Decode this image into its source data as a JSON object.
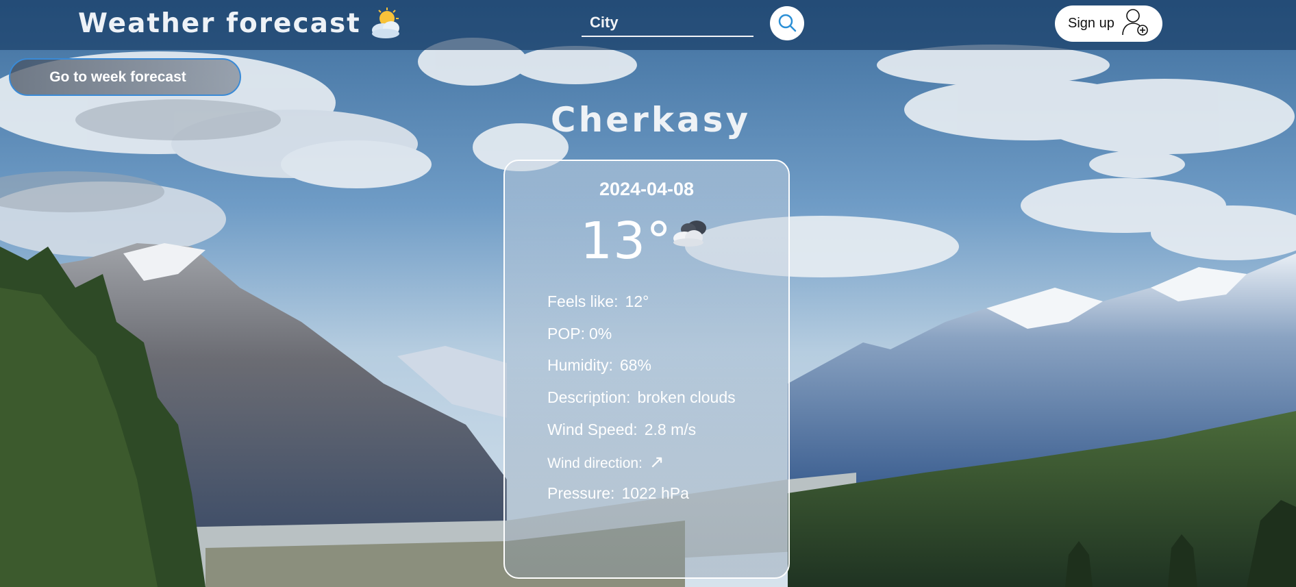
{
  "header": {
    "title": "Weather forecast",
    "title_icon": "partly-cloudy-sun-icon",
    "search": {
      "placeholder": "City",
      "value": ""
    },
    "search_icon": "search-icon",
    "signup_label": "Sign up",
    "signup_icon": "user-add-icon"
  },
  "week_forecast_label": "Go to week forecast",
  "city": "Cherkasy",
  "card": {
    "date": "2024-04-08",
    "temperature": "13°",
    "weather_icon": "broken-clouds-icon",
    "feels_like_label": "Feels like:",
    "feels_like_value": "12°",
    "pop_label": "POP:",
    "pop_value": "0%",
    "humidity_label": "Humidity:",
    "humidity_value": "68%",
    "description_label": "Description:",
    "description_value": "broken clouds",
    "wind_speed_label": "Wind Speed:",
    "wind_speed_value": "2.8 m/s",
    "wind_direction_label": "Wind direction:",
    "wind_direction_value": "↗",
    "pressure_label": "Pressure:",
    "pressure_value": "1022 hPa"
  },
  "colors": {
    "header_bg": "#14375f",
    "accent_blue": "#3a8ad6",
    "search_icon": "#2a8fd6",
    "text": "#ffffff"
  }
}
